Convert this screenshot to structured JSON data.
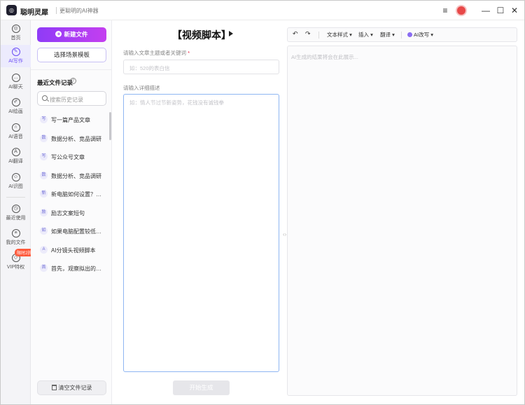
{
  "app": {
    "name": "聪明灵犀",
    "slogan": "更聪明的AI神器",
    "logo_text": "◎"
  },
  "nav": [
    {
      "label": "首页",
      "icon": "home-icon",
      "glyph": "◎"
    },
    {
      "label": "AI写作",
      "icon": "pen-icon",
      "glyph": "✎",
      "active": true
    },
    {
      "label": "AI聊天",
      "icon": "chat-icon",
      "glyph": "…"
    },
    {
      "label": "AI绘画",
      "icon": "brush-icon",
      "glyph": "✐"
    },
    {
      "label": "AI语音",
      "icon": "headphones-icon",
      "glyph": "∩"
    },
    {
      "label": "AI翻译",
      "icon": "translate-icon",
      "glyph": "A"
    },
    {
      "label": "AI识图",
      "icon": "scan-icon",
      "glyph": "☺"
    },
    {
      "label": "最近使用",
      "icon": "clock-icon",
      "glyph": "◷"
    },
    {
      "label": "我的文件",
      "icon": "file-icon",
      "glyph": "≡"
    },
    {
      "label": "VIP特权",
      "icon": "diamond-icon",
      "glyph": "◇",
      "badge": "限时2折"
    }
  ],
  "files": {
    "new_button": "新建文件",
    "scene_button": "选择场景模板",
    "recent_title": "最近文件记录",
    "search_placeholder": "搜索历史记录",
    "clear_button": "清空文件记录",
    "items": [
      {
        "badge": "写",
        "text": "写一篇产品文章"
      },
      {
        "badge": "数",
        "text": "数据分析、竞品调研"
      },
      {
        "badge": "写",
        "text": "写公众号文章"
      },
      {
        "badge": "数",
        "text": "数据分析、竞品调研"
      },
      {
        "badge": "新",
        "text": "新电脑如何设置？提..."
      },
      {
        "badge": "励",
        "text": "励志文案短句"
      },
      {
        "badge": "如",
        "text": "如果电脑配置较低，..."
      },
      {
        "badge": "A",
        "text": "AI分镜头视频脚本"
      },
      {
        "badge": "首",
        "text": "首先，观察拟出的图..."
      }
    ]
  },
  "editor": {
    "doc_title": "【视频脚本】",
    "topic_label": "请输入文章主题或者关键词",
    "topic_required": "*",
    "topic_placeholder": "如：520的表白信",
    "detail_label": "请输入详细描述",
    "detail_placeholder": "如：情人节过节新姿势，花钱没有诚钱拳",
    "generate_button": "开始生成"
  },
  "output": {
    "toolbar": {
      "text_style": "文本样式",
      "insert": "插入",
      "translate": "翻译",
      "ai_rewrite": "AI改写"
    },
    "placeholder": "AI生成的结果将会在此展示..."
  },
  "colors": {
    "accent": "#6a4cf5",
    "new_button_start": "#8f3cf7",
    "new_button_end": "#c43ef0"
  }
}
